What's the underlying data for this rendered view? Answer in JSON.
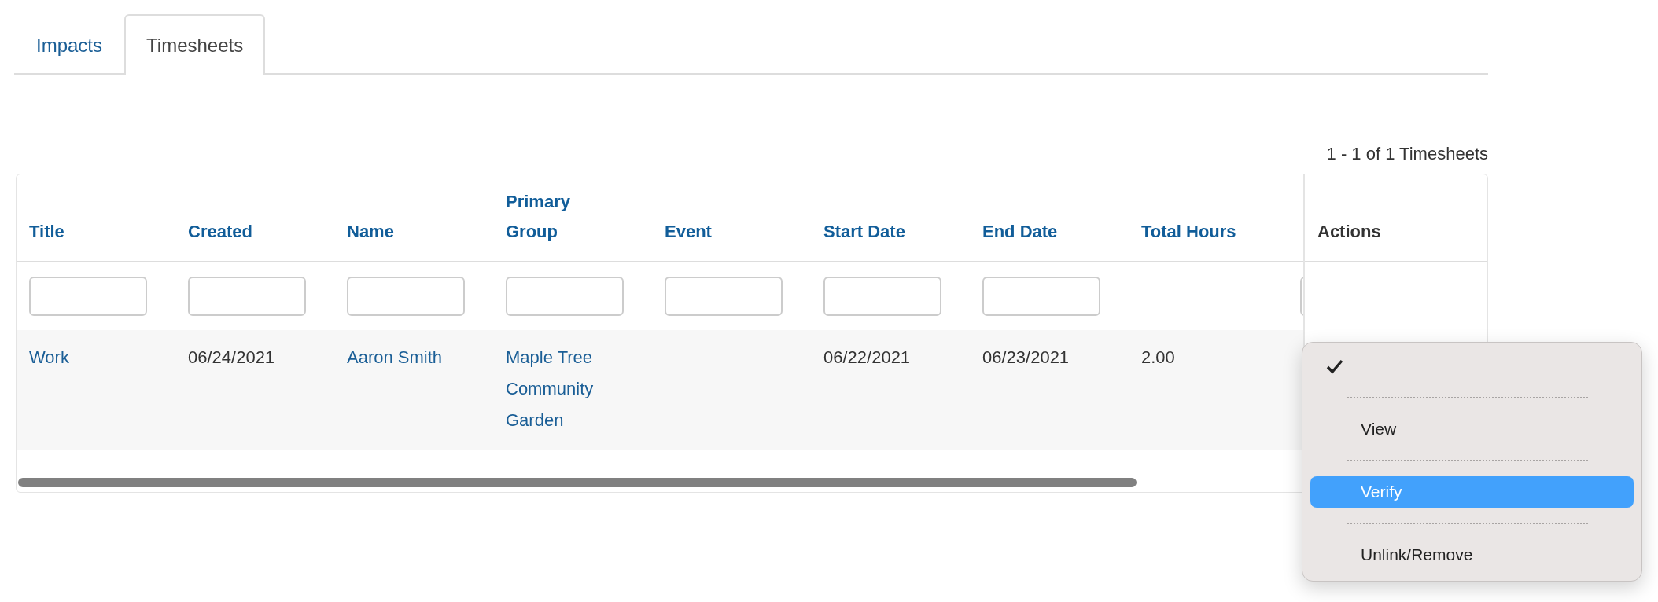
{
  "tabs": [
    {
      "label": "Impacts",
      "selected": false
    },
    {
      "label": "Timesheets",
      "selected": true
    }
  ],
  "pagination": "1 - 1 of 1 Timesheets",
  "table": {
    "columns": [
      {
        "title": "Title",
        "filter": true
      },
      {
        "title": "Created",
        "filter": true
      },
      {
        "title": "Name",
        "filter": true
      },
      {
        "title": "Primary Group",
        "filter": true
      },
      {
        "title": "Event",
        "filter": true
      },
      {
        "title": "Start Date",
        "filter": true
      },
      {
        "title": "End Date",
        "filter": true
      },
      {
        "title": "Total Hours",
        "filter": false
      },
      {
        "filter": true
      }
    ],
    "actions_column": "Actions",
    "rows": [
      {
        "cells": [
          {
            "kind": "link",
            "text": "Work"
          },
          {
            "kind": "text",
            "text": "06/24/2021"
          },
          {
            "kind": "link",
            "text": "Aaron Smith"
          },
          {
            "kind": "link",
            "text": "Maple Tree Community Garden"
          },
          {
            "kind": "empty"
          },
          {
            "kind": "text",
            "text": "06/22/2021"
          },
          {
            "kind": "text",
            "text": "06/23/2021"
          },
          {
            "kind": "text",
            "text": "2.00"
          },
          {
            "kind": "empty"
          }
        ]
      }
    ]
  },
  "menu": {
    "items": [
      {
        "kind": "checkmark",
        "checked": true
      },
      {
        "kind": "separator"
      },
      {
        "kind": "option",
        "label": "View",
        "selected": false
      },
      {
        "kind": "separator"
      },
      {
        "kind": "option",
        "label": "Verify",
        "selected": true
      },
      {
        "kind": "separator"
      },
      {
        "kind": "option",
        "label": "Unlink/Remove",
        "selected": false
      }
    ]
  }
}
